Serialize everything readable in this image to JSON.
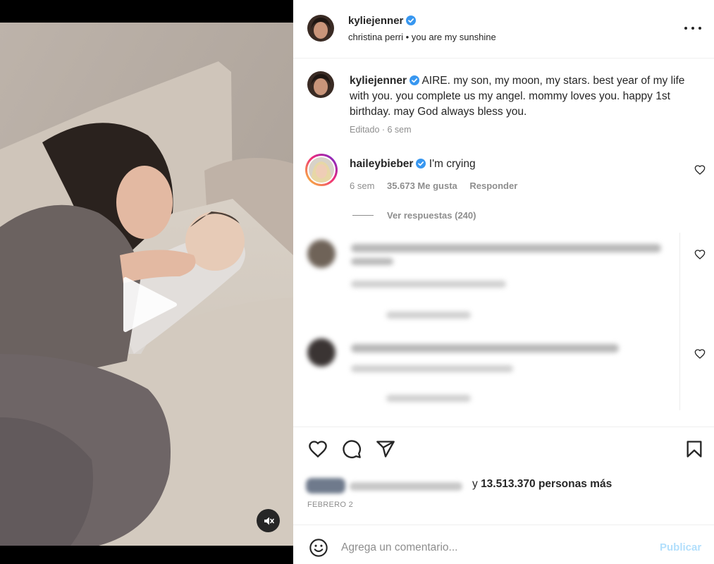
{
  "post": {
    "username": "kyliejenner",
    "audio": "christina perri • you are my sunshine",
    "more_icon": "more-horizontal-icon"
  },
  "caption": {
    "username": "kyliejenner",
    "text": "AIRE. my son, my moon, my stars. best year of my life with you. you complete us my angel. mommy loves you. happy 1st birthday. may God always bless you.",
    "meta": "Editado · 6 sem"
  },
  "top_comment": {
    "username": "haileybieber",
    "text": "I'm crying",
    "time": "6 sem",
    "likes": "35.673 Me gusta",
    "reply_label": "Responder",
    "view_replies": "Ver respuestas (240)"
  },
  "likes_summary": {
    "count_text": "13.513.370 personas más",
    "prefix": "y"
  },
  "date": "FEBRERO 2",
  "composer": {
    "placeholder": "Agrega un comentario...",
    "publish_label": "Publicar"
  },
  "colors": {
    "verified": "#3897f0",
    "meta_gray": "#8e8e8e",
    "publish_disabled": "#b2dffc"
  },
  "icons": {
    "play": "play-icon",
    "mute": "muted-speaker-icon",
    "like": "heart-icon",
    "comment": "comment-bubble-icon",
    "share": "paper-plane-icon",
    "save": "bookmark-icon",
    "emoji": "smiley-icon"
  }
}
